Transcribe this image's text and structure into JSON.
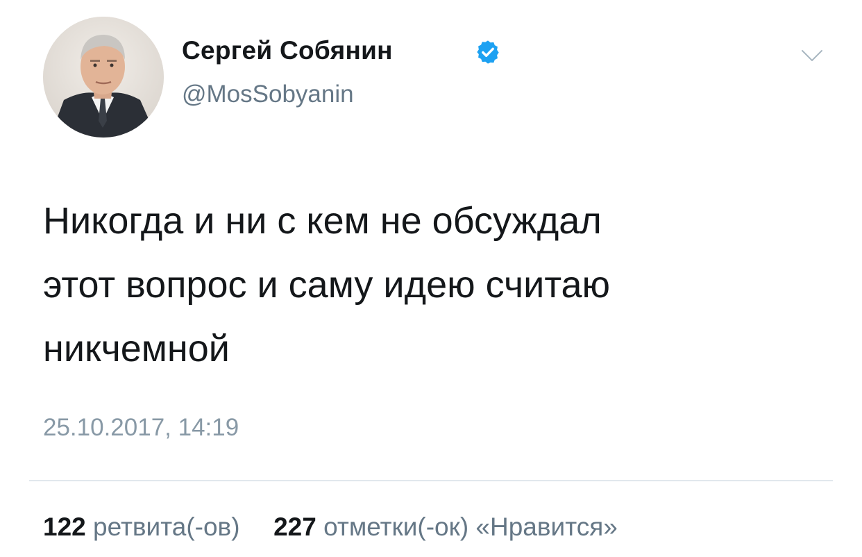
{
  "author": {
    "name": "Сергей Собянин",
    "handle": "@MosSobyanin",
    "verified": true
  },
  "icons": {
    "verified": "verified-badge-icon",
    "menu": "chevron-down-icon",
    "avatar": "profile-photo"
  },
  "colors": {
    "verified_blue": "#1da1f2",
    "text_primary": "#14171a",
    "text_secondary": "#657786",
    "divider": "#e1e8ed"
  },
  "tweet": {
    "lines": [
      "Никогда и ни с кем не обсуждал",
      "этот вопрос и саму идею считаю",
      "никчемной"
    ],
    "timestamp": "25.10.2017, 14:19"
  },
  "stats": {
    "retweets_count": "122",
    "retweets_label": "ретвита(-ов)",
    "likes_count": "227",
    "likes_label": "отметки(-ок) «Нравится»"
  }
}
